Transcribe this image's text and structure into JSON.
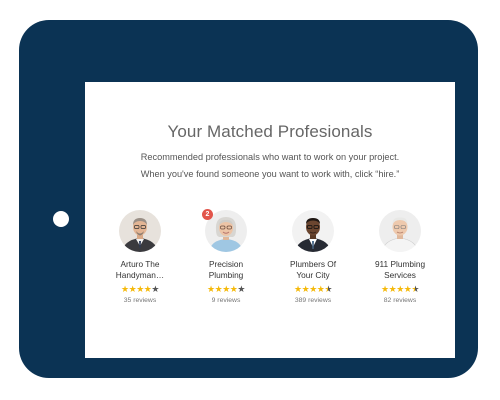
{
  "page": {
    "title": "Your Matched Profesionals",
    "subtitle_line1": "Recommended professionals who want to work on your project.",
    "subtitle_line2": "When you've found someone you want to work with, click “hire.”"
  },
  "colors": {
    "tablet_frame": "#0b3354",
    "star": "#f5b90a",
    "badge": "#e2554b"
  },
  "professionals": [
    {
      "name_line1": "Arturo The",
      "name_line2": "Handyman…",
      "rating": 4,
      "reviews": "35 reviews",
      "badge": ""
    },
    {
      "name_line1": "Precision",
      "name_line2": "Plumbing",
      "rating": 4,
      "reviews": "9 reviews",
      "badge": "2"
    },
    {
      "name_line1": "Plumbers Of",
      "name_line2": "Your City",
      "rating": 4.5,
      "reviews": "389 reviews",
      "badge": ""
    },
    {
      "name_line1": "911 Plumbing",
      "name_line2": "Services",
      "rating": 4.5,
      "reviews": "82 reviews",
      "badge": ""
    }
  ]
}
